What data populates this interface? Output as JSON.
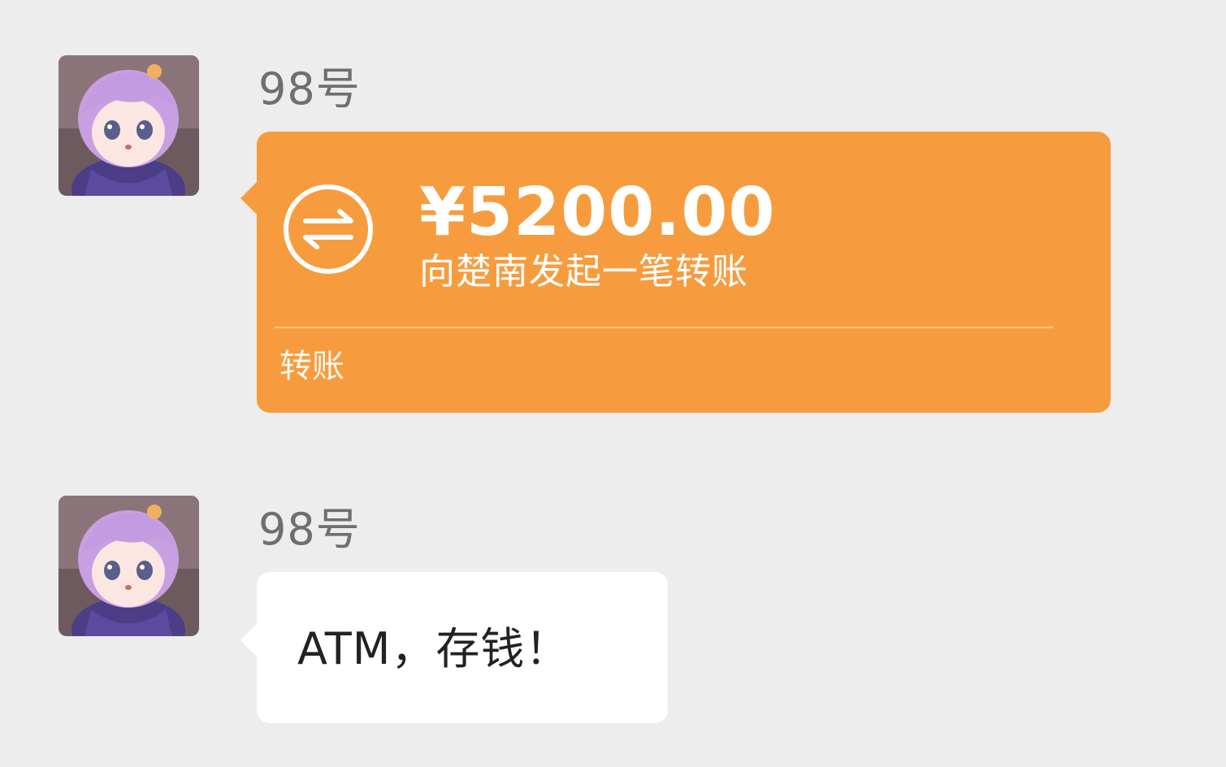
{
  "messages": [
    {
      "sender": "98号",
      "avatar_icon": "anime-girl-avatar-icon",
      "type": "transfer",
      "transfer": {
        "amount": "¥5200.00",
        "description": "向楚南发起一笔转账",
        "footer": "转账",
        "icon": "transfer-arrows-icon",
        "color": "#f79c3e"
      }
    },
    {
      "sender": "98号",
      "avatar_icon": "anime-girl-avatar-icon",
      "type": "text",
      "text": "ATM，存钱！"
    }
  ],
  "colors": {
    "background": "#ededed",
    "transfer_card": "#f79c3e",
    "text_bubble": "#ffffff",
    "sender_name": "#6f6f6f"
  }
}
